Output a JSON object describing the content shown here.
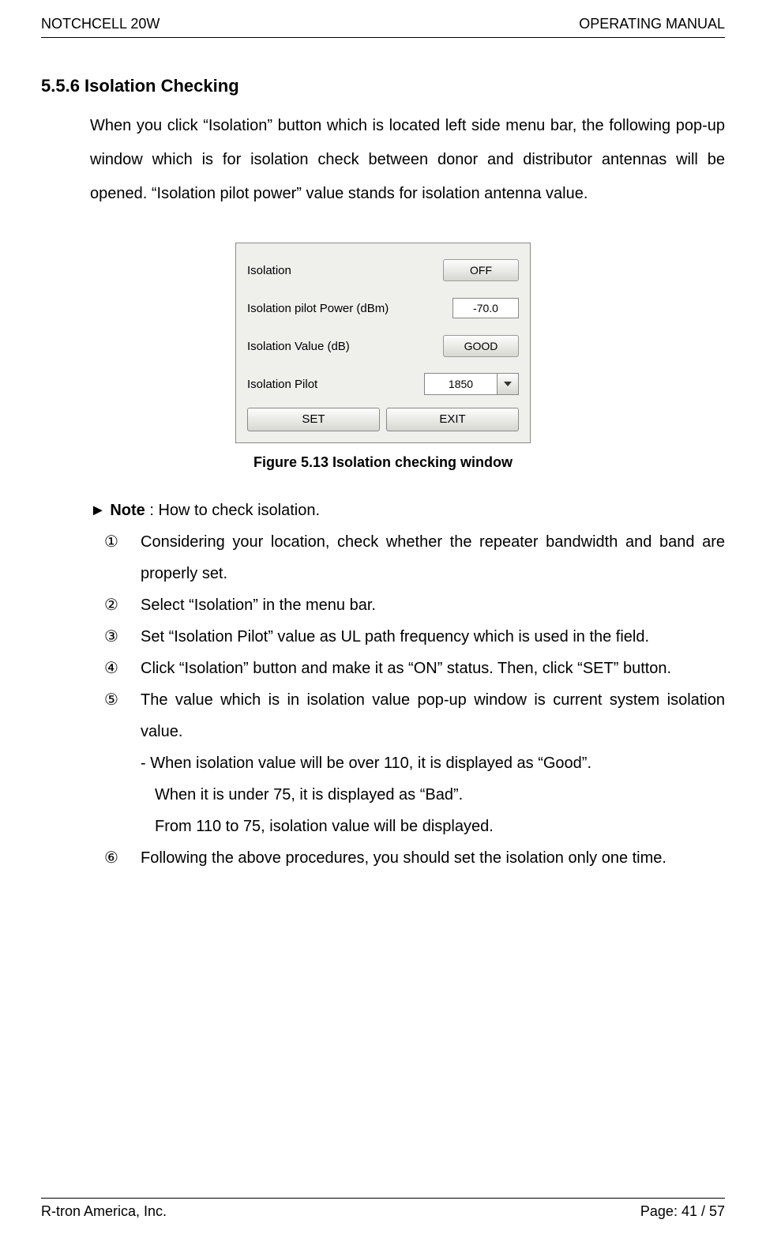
{
  "header": {
    "left": "NOTCHCELL 20W",
    "right": "OPERATING MANUAL"
  },
  "section_title": "5.5.6 Isolation Checking",
  "intro": "When you click “Isolation” button which is located left side menu bar, the following pop-up window which is for isolation check between donor and distributor antennas will be opened.   “Isolation pilot power” value stands for isolation antenna value.",
  "dialog": {
    "rows": [
      {
        "label": "Isolation",
        "value": "OFF",
        "kind": "button"
      },
      {
        "label": "Isolation pilot Power (dBm)",
        "value": "-70.0",
        "kind": "text"
      },
      {
        "label": "Isolation Value (dB)",
        "value": "GOOD",
        "kind": "button"
      },
      {
        "label": "Isolation Pilot",
        "value": "1850",
        "kind": "combo"
      }
    ],
    "set": "SET",
    "exit": "EXIT"
  },
  "caption": "Figure 5.13 Isolation checking window",
  "note_marker": "►",
  "note_label": "Note",
  "note_rest": " : How to check isolation.",
  "steps": [
    "Considering your location, check whether the repeater bandwidth and band are properly set.",
    "Select “Isolation” in the menu bar.",
    "Set “Isolation Pilot” value as UL path frequency which is used in the field.",
    "Click “Isolation” button and make it as “ON” status. Then, click “SET” button.",
    "The value which is in isolation value pop-up window is current system isolation value.",
    "Following the above procedures, you should set the isolation only one time."
  ],
  "step5_sub": [
    "- When isolation value will be over 110, it is displayed as “Good”.",
    "When it is under 75, it is displayed as “Bad”.",
    "From 110 to 75, isolation value will be displayed."
  ],
  "circled": [
    "①",
    "②",
    "③",
    "④",
    "⑤",
    "⑥"
  ],
  "footer": {
    "left": "R-tron America, Inc.",
    "right": "Page: 41 / 57"
  }
}
